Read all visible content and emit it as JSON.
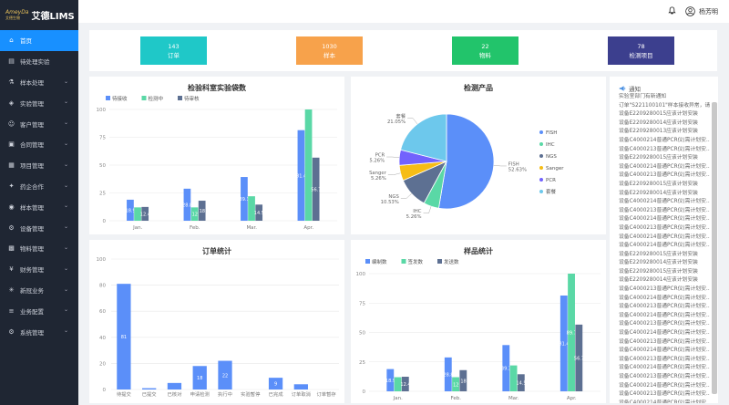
{
  "app": {
    "brand_script": "AmeyDa",
    "brand_small": "艾德生物",
    "title": "艾德LIMS"
  },
  "sidebar": {
    "items": [
      {
        "label": "首页",
        "icon": "home-icon",
        "active": true,
        "expandable": false
      },
      {
        "label": "待处理实验",
        "icon": "clipboard-icon",
        "active": false,
        "expandable": false
      },
      {
        "label": "样本处理",
        "icon": "flask-icon",
        "active": false,
        "expandable": true
      },
      {
        "label": "实验管理",
        "icon": "experiment-icon",
        "active": false,
        "expandable": true
      },
      {
        "label": "客户管理",
        "icon": "customer-icon",
        "active": false,
        "expandable": true
      },
      {
        "label": "合同管理",
        "icon": "contract-icon",
        "active": false,
        "expandable": true
      },
      {
        "label": "项目管理",
        "icon": "project-icon",
        "active": false,
        "expandable": true
      },
      {
        "label": "药企合作",
        "icon": "handshake-icon",
        "active": false,
        "expandable": true
      },
      {
        "label": "样本管理",
        "icon": "sample-icon",
        "active": false,
        "expandable": true
      },
      {
        "label": "设备管理",
        "icon": "device-icon",
        "active": false,
        "expandable": true
      },
      {
        "label": "物料管理",
        "icon": "material-icon",
        "active": false,
        "expandable": true
      },
      {
        "label": "财务管理",
        "icon": "finance-icon",
        "active": false,
        "expandable": true
      },
      {
        "label": "新冠业务",
        "icon": "virus-icon",
        "active": false,
        "expandable": true
      },
      {
        "label": "业务配置",
        "icon": "config-icon",
        "active": false,
        "expandable": true
      },
      {
        "label": "系统管理",
        "icon": "gear-icon",
        "active": false,
        "expandable": true
      }
    ]
  },
  "header": {
    "user_name": "杨芳明",
    "bell_icon": "bell-icon",
    "user_icon": "user-icon"
  },
  "stats": [
    {
      "value": "143",
      "label": "订单",
      "color": "#1fc8c8"
    },
    {
      "value": "1030",
      "label": "样本",
      "color": "#f7a24b"
    },
    {
      "value": "22",
      "label": "物料",
      "color": "#22c46b"
    },
    {
      "value": "78",
      "label": "检测项目",
      "color": "#3c3f8e"
    }
  ],
  "notice": {
    "title": "通知",
    "icon": "megaphone-icon",
    "lines": [
      "实验室部门有新通知",
      "订单\"S221100101\"样本接收异常，请…",
      "设备E2209280015应该计划安装",
      "设备E2209280014应该计划安装",
      "设备E2209280013应该计划安装",
      "设备C4000214普通PCR仪(需计划安…",
      "设备C4000213普通PCR仪(需计划安…",
      "设备E2209280015应该计划安装",
      "设备C4000214普通PCR仪(需计划安…",
      "设备C4000213普通PCR仪(需计划安…",
      "设备E2209280015应该计划安装",
      "设备E2209280014应该计划安装",
      "设备C4000214普通PCR仪(需计划安…",
      "设备C4000213普通PCR仪(需计划安…",
      "设备C4000214普通PCR仪(需计划安…",
      "设备C4000213普通PCR仪(需计划安…",
      "设备C4000214普通PCR仪(需计划安…",
      "设备C4000214普通PCR仪(需计划安…",
      "设备E2209280015应该计划安装",
      "设备E2209280014应该计划安装",
      "设备E2209280015应该计划安装",
      "设备E2209280014应该计划安装",
      "设备C4000213普通PCR仪(需计划安…",
      "设备C4000214普通PCR仪(需计划安…",
      "设备C4000213普通PCR仪(需计划安…",
      "设备C4000214普通PCR仪(需计划安…",
      "设备C4000213普通PCR仪(需计划安…",
      "设备C4000214普通PCR仪(需计划安…",
      "设备C4000213普通PCR仪(需计划安…",
      "设备C4000214普通PCR仪(需计划安…",
      "设备C4000213普通PCR仪(需计划安…",
      "设备C4000214普通PCR仪(需计划安…",
      "设备C4000213普通PCR仪(需计划安…",
      "设备C4000214普通PCR仪(需计划安…",
      "设备C4000213普通PCR仪(需计划安…",
      "设备C4000214普通PCR仪(需计划安…"
    ]
  },
  "chart_data": [
    {
      "id": "lab",
      "type": "bar",
      "title": "检验科室实验袋数",
      "categories": [
        "Jan.",
        "Feb.",
        "Mar.",
        "Apr."
      ],
      "ylim": [
        0,
        100
      ],
      "yticks": [
        0,
        25,
        50,
        75,
        100
      ],
      "legend_position": "top-left",
      "series": [
        {
          "name": "待接收",
          "color": "#5b8ff9",
          "values": [
            18.9,
            28.8,
            39.3,
            81.4
          ]
        },
        {
          "name": "检测中",
          "color": "#5ad8a6",
          "values": [
            12,
            12,
            22,
            100
          ]
        },
        {
          "name": "待审核",
          "color": "#5d7092",
          "values": [
            12.4,
            18,
            14.5,
            56.7
          ]
        }
      ],
      "data_labels": [
        [
          "18.9",
          "28.8",
          "39.3",
          "81.4"
        ],
        [
          "",
          "12",
          "",
          ""
        ],
        [
          "12.4",
          "18",
          "14.5",
          "56.7"
        ]
      ]
    },
    {
      "id": "product",
      "type": "pie",
      "title": "检测产品",
      "legend_position": "right",
      "slices": [
        {
          "name": "FISH",
          "value": 52.63,
          "label": "FISH\n52.63%",
          "color": "#5b8ff9"
        },
        {
          "name": "IHC",
          "value": 5.26,
          "label": "IHC\n5.26%",
          "color": "#5ad8a6"
        },
        {
          "name": "NGS",
          "value": 10.53,
          "label": "NGS\n10.53%",
          "color": "#5d7092"
        },
        {
          "name": "Sanger",
          "value": 5.26,
          "label": "Sanger\n5.26%",
          "color": "#f6bd16"
        },
        {
          "name": "PCR",
          "value": 5.26,
          "label": "PCR\n5.26%",
          "color": "#7262fd"
        },
        {
          "name": "套餐",
          "value": 21.05,
          "label": "套餐\n21.05%",
          "color": "#6dc8ec"
        }
      ]
    },
    {
      "id": "order",
      "type": "bar",
      "title": "订单统计",
      "categories": [
        "待提交",
        "已提交",
        "已核对",
        "申请检测",
        "执行中",
        "实验暂停",
        "已完成",
        "订单取消",
        "订单暂存"
      ],
      "ylim": [
        0,
        100
      ],
      "yticks": [
        0,
        20,
        40,
        60,
        80,
        100
      ],
      "color": "#5b8ff9",
      "values": [
        81,
        1,
        5,
        18,
        22,
        0,
        9,
        4,
        0
      ],
      "data_labels": [
        "81",
        "",
        "",
        "18",
        "22",
        "",
        "9",
        "",
        ""
      ]
    },
    {
      "id": "sample",
      "type": "bar",
      "title": "样品统计",
      "categories": [
        "Jan.",
        "Feb.",
        "Mar.",
        "Apr."
      ],
      "ylim": [
        0,
        100
      ],
      "yticks": [
        0,
        25,
        50,
        75,
        100
      ],
      "legend_position": "top-left",
      "series": [
        {
          "name": "编制数",
          "color": "#5b8ff9",
          "values": [
            18.9,
            28.8,
            39.3,
            81.4
          ]
        },
        {
          "name": "签发数",
          "color": "#5ad8a6",
          "values": [
            12,
            12,
            22,
            100
          ]
        },
        {
          "name": "发送数",
          "color": "#5d7092",
          "values": [
            12.4,
            18,
            14.5,
            56.7
          ]
        }
      ],
      "data_labels": [
        [
          "18.9",
          "28.8",
          "39.3",
          "81.4"
        ],
        [
          "",
          "12",
          "",
          "89.7"
        ],
        [
          "12.4",
          "18",
          "14.5",
          "56.7"
        ]
      ]
    }
  ]
}
